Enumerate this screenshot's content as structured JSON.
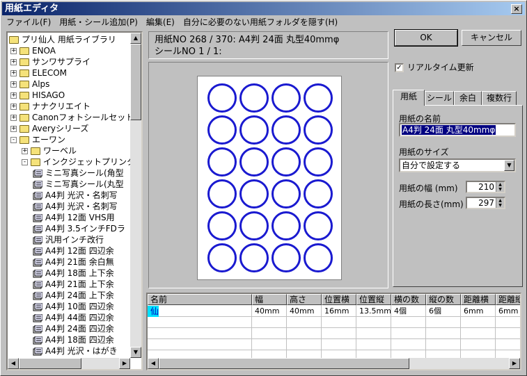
{
  "window": {
    "title": "用紙エディタ",
    "close_glyph": "×"
  },
  "menu": [
    "ファイル(F)",
    "用紙・シール追加(P)",
    "編集(E)",
    "自分に必要のない用紙フォルダを隠す(H)"
  ],
  "tree": {
    "items": [
      {
        "label": "プリ仙人 用紙ライブラリ",
        "level": 0,
        "type": "root"
      },
      {
        "label": "ENOA",
        "level": 1,
        "type": "folder",
        "pm": "+"
      },
      {
        "label": "サンワサプライ",
        "level": 1,
        "type": "folder",
        "pm": "+"
      },
      {
        "label": "ELECOM",
        "level": 1,
        "type": "folder",
        "pm": "+"
      },
      {
        "label": "Alps",
        "level": 1,
        "type": "folder",
        "pm": "+"
      },
      {
        "label": "HISAGO",
        "level": 1,
        "type": "folder",
        "pm": "+"
      },
      {
        "label": "ナナクリエイト",
        "level": 1,
        "type": "folder",
        "pm": "+"
      },
      {
        "label": "Canonフォトシールセット",
        "level": 1,
        "type": "folder",
        "pm": "+"
      },
      {
        "label": "Averyシリーズ",
        "level": 1,
        "type": "folder",
        "pm": "+"
      },
      {
        "label": "エーワン",
        "level": 1,
        "type": "folder",
        "pm": "-"
      },
      {
        "label": "ワーベル",
        "level": 2,
        "type": "folder",
        "pm": "+"
      },
      {
        "label": "インクジェットプリンタラベ",
        "level": 2,
        "type": "folder",
        "pm": "-"
      },
      {
        "label": "ミニ写真シール(角型",
        "level": 3,
        "type": "doc"
      },
      {
        "label": "ミニ写真シール(丸型",
        "level": 3,
        "type": "doc"
      },
      {
        "label": "A4判 光沢・名刺写",
        "level": 3,
        "type": "doc"
      },
      {
        "label": "A4判 光沢・名刺写",
        "level": 3,
        "type": "doc"
      },
      {
        "label": "A4判 12面 VHS用",
        "level": 3,
        "type": "doc"
      },
      {
        "label": "A4判 3.5インチFDラ",
        "level": 3,
        "type": "doc"
      },
      {
        "label": "汎用インチ改行",
        "level": 3,
        "type": "doc"
      },
      {
        "label": "A4判 12面 四辺余",
        "level": 3,
        "type": "doc"
      },
      {
        "label": "A4判 21面 余白無",
        "level": 3,
        "type": "doc"
      },
      {
        "label": "A4判 18面 上下余",
        "level": 3,
        "type": "doc"
      },
      {
        "label": "A4判 21面 上下余",
        "level": 3,
        "type": "doc"
      },
      {
        "label": "A4判 24面 上下余",
        "level": 3,
        "type": "doc"
      },
      {
        "label": "A4判 10面 四辺余",
        "level": 3,
        "type": "doc"
      },
      {
        "label": "A4判 44面 四辺余",
        "level": 3,
        "type": "doc"
      },
      {
        "label": "A4判 24面 四辺余",
        "level": 3,
        "type": "doc"
      },
      {
        "label": "A4判 18面 四辺余",
        "level": 3,
        "type": "doc"
      },
      {
        "label": "A4判 光沢・はがき",
        "level": 3,
        "type": "doc"
      }
    ]
  },
  "info": {
    "line1": "用紙NO 268 / 370: A4判 24面 丸型40mmφ",
    "line2": "シールNO 1 / 1:"
  },
  "buttons": {
    "ok": "OK",
    "cancel": "キャンセル"
  },
  "realtime": {
    "label": "リアルタイム更新",
    "checked": true
  },
  "tabs": [
    "用紙",
    "シール",
    "余白",
    "複数行"
  ],
  "paper": {
    "name_label": "用紙の名前",
    "name_value": "A4判 24面 丸型40mmφ",
    "size_label": "用紙のサイズ",
    "size_value": "自分で設定する",
    "width_label": "用紙の幅 (mm)",
    "width_value": "210",
    "length_label": "用紙の長さ(mm)",
    "length_value": "297"
  },
  "preview": {
    "rows": 6,
    "cols": 4
  },
  "grid": {
    "headers": [
      "名前",
      "幅",
      "高さ",
      "位置横",
      "位置縦",
      "横の数",
      "縦の数",
      "距離横",
      "距離縦"
    ],
    "rows": [
      [
        "仙",
        "40mm",
        "40mm",
        "16mm",
        "13.5mm",
        "4個",
        "6個",
        "6mm",
        "6mm"
      ]
    ]
  },
  "colors": {
    "title_start": "#0a246a",
    "title_end": "#a6caf0",
    "circle": "#1a1ad0",
    "selection": "#000080"
  }
}
